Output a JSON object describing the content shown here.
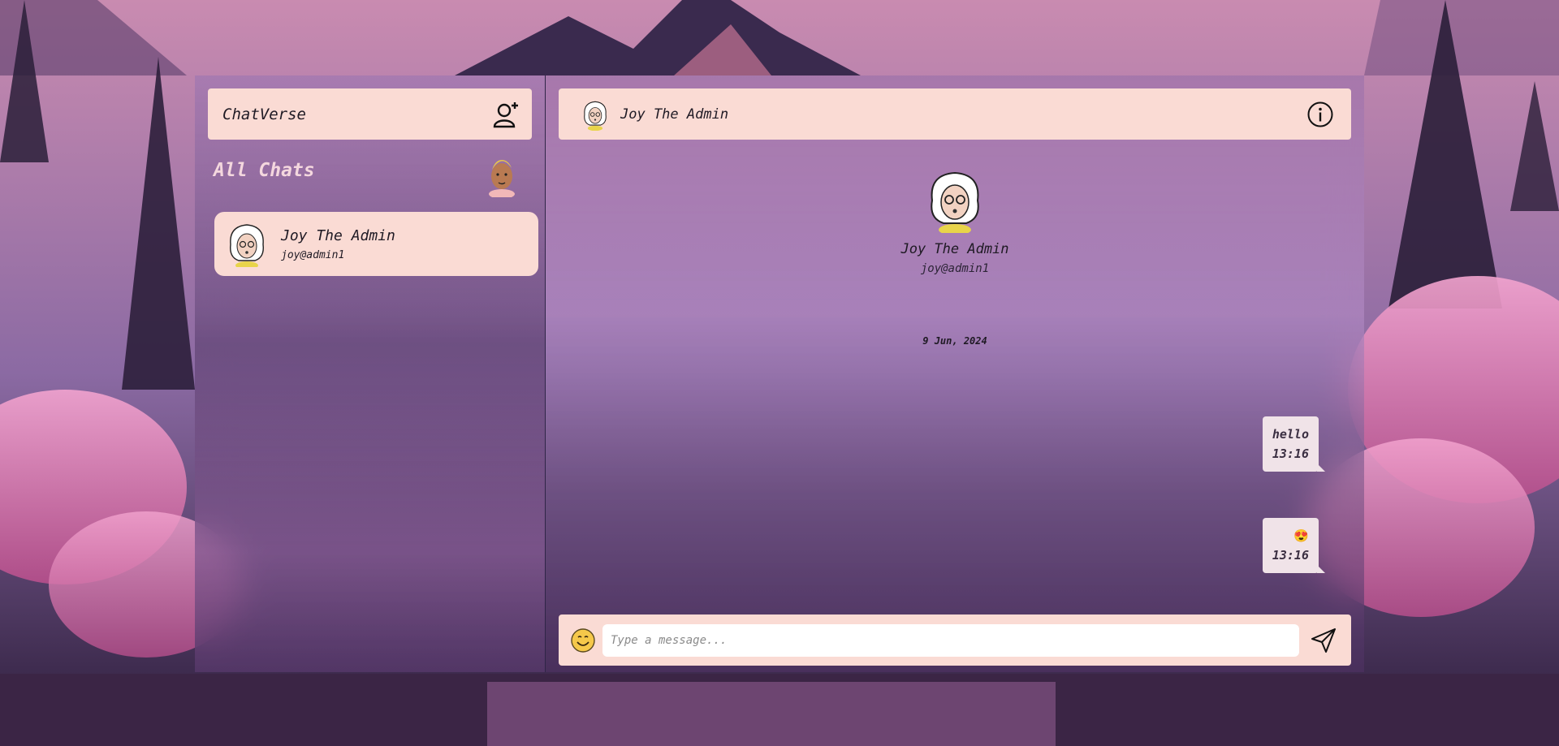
{
  "app": {
    "title": "ChatVerse",
    "add_user_icon": "add-user-icon"
  },
  "sidebar": {
    "section_title": "All Chats",
    "chats": [
      {
        "name": "Joy The Admin",
        "handle": "joy@admin1"
      }
    ]
  },
  "chat": {
    "header_name": "Joy The Admin",
    "info_icon": "info-icon",
    "profile_name": "Joy The Admin",
    "profile_handle": "joy@admin1",
    "date": "9 Jun, 2024",
    "messages": [
      {
        "text": "hello",
        "time": "13:16"
      },
      {
        "text": "😍",
        "time": "13:16"
      }
    ]
  },
  "composer": {
    "placeholder": "Type a message...",
    "emoji_icon": "smile-icon",
    "send_icon": "send-icon"
  },
  "colors": {
    "panel": "#fadbd4",
    "bubble": "#f0e3e8",
    "accent": "#f4d7de"
  }
}
